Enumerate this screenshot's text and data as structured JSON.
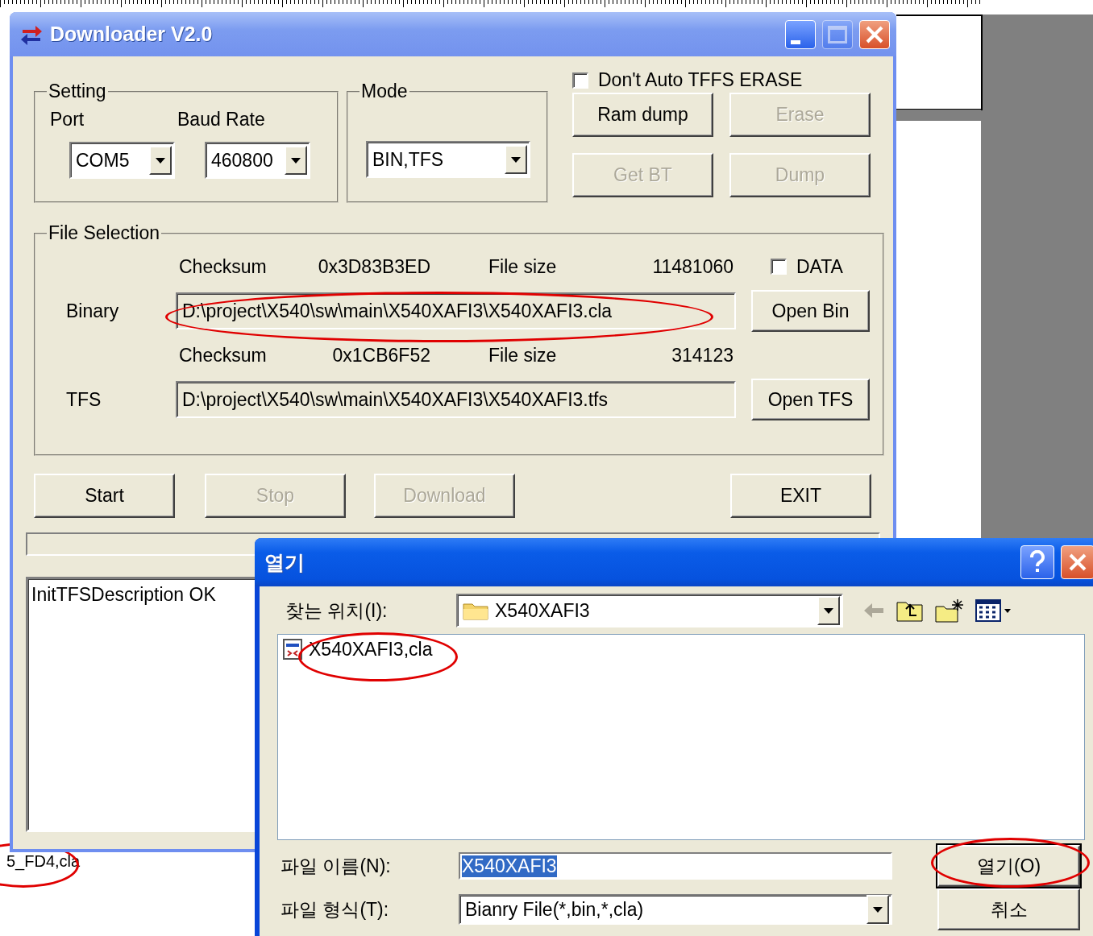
{
  "main_window": {
    "title": "Downloader V2.0",
    "title_buttons": [
      {
        "kind": "minimize",
        "disabled": false
      },
      {
        "kind": "maximize",
        "disabled": true
      },
      {
        "kind": "close",
        "disabled": false
      }
    ],
    "setting": {
      "title": "Setting",
      "port_label": "Port",
      "baud_label": "Baud Rate",
      "port": "COM5",
      "baud": "460800"
    },
    "mode": {
      "title": "Mode",
      "value": "BIN,TFS"
    },
    "auto_erase_checkbox": {
      "label": "Don't Auto TFFS ERASE",
      "checked": false
    },
    "action_buttons": [
      {
        "label": "Ram dump",
        "disabled": false
      },
      {
        "label": "Erase",
        "disabled": true
      },
      {
        "label": "Get BT",
        "disabled": true
      },
      {
        "label": "Dump",
        "disabled": true
      }
    ],
    "file_selection": {
      "title": "File Selection",
      "files": [
        {
          "checksum_label": "Checksum",
          "checksum": "0x3D83B3ED",
          "size_label": "File size",
          "size": "11481060",
          "label": "Binary",
          "path": "D:\\project\\X540\\sw\\main\\X540XAFI3\\X540XAFI3.cla",
          "button": "Open Bin",
          "data_checkbox": {
            "label": "DATA",
            "checked": false
          }
        },
        {
          "checksum_label": "Checksum",
          "checksum": "0x1CB6F52",
          "size_label": "File size",
          "size": "314123",
          "label": "TFS",
          "path": "D:\\project\\X540\\sw\\main\\X540XAFI3\\X540XAFI3.tfs",
          "button": "Open TFS"
        }
      ]
    },
    "buttons": [
      {
        "label": "Start",
        "disabled": false
      },
      {
        "label": "Stop",
        "disabled": true
      },
      {
        "label": "Download",
        "disabled": true
      },
      {
        "label": "EXIT",
        "disabled": false
      }
    ],
    "log": [
      "InitTFSDescription OK"
    ]
  },
  "open_dialog": {
    "title": "열기",
    "look_in_label": "찾는 위치(I):",
    "look_in": "X540XAFI3",
    "files": [
      "X540XAFI3,cla"
    ],
    "file_name_label": "파일 이름(N):",
    "file_name": {
      "value": "X540XAFI3",
      "text_selected": true
    },
    "file_type_label": "파일 형식(T):",
    "file_type": "Bianry File(*,bin,*,cla)",
    "buttons": [
      {
        "label": "열기(O)",
        "default": true
      },
      {
        "label": "취소",
        "default": false
      }
    ]
  },
  "background_text": "5_FD4,cla"
}
